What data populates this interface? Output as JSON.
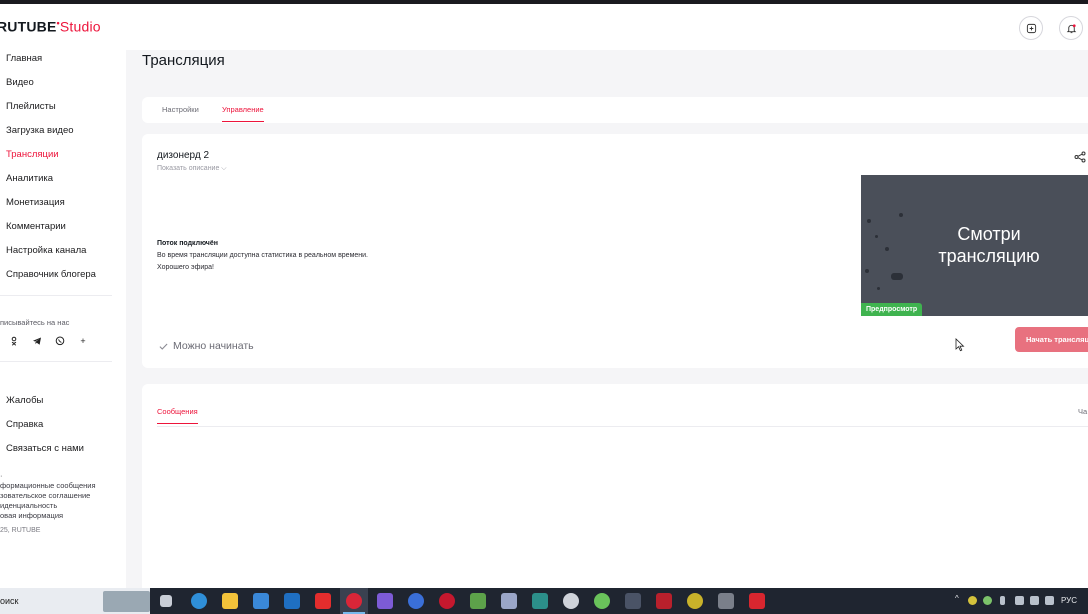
{
  "header": {
    "logo_main": "RUTUBE",
    "logo_studio": "Studio",
    "create_icon": "plus-square-icon",
    "notify_icon": "bell-icon"
  },
  "sidebar": {
    "items": [
      {
        "label": "Главная",
        "active": false
      },
      {
        "label": "Видео",
        "active": false
      },
      {
        "label": "Плейлисты",
        "active": false
      },
      {
        "label": "Загрузка видео",
        "active": false
      },
      {
        "label": "Трансляции",
        "active": true
      },
      {
        "label": "Аналитика",
        "active": false
      },
      {
        "label": "Монетизация",
        "active": false
      },
      {
        "label": "Комментарии",
        "active": false
      },
      {
        "label": "Настройка канала",
        "active": false
      },
      {
        "label": "Справочник блогера",
        "active": false
      }
    ],
    "subscribe_label": "писывайтесь на нас",
    "social_plus": "+",
    "support_items": [
      "Жалобы",
      "Справка",
      "Связаться с нами"
    ],
    "footer_links": [
      "формационные сообщения",
      "зовательское соглашение",
      "иденциальность",
      "овая информация"
    ],
    "footer_dot": "·",
    "copyright": "25, RUTUBE"
  },
  "main": {
    "page_title": "Трансляция",
    "tabs": [
      {
        "label": "Настройки",
        "active": false
      },
      {
        "label": "Управление",
        "active": true
      }
    ],
    "stream": {
      "title": "дизонерд 2",
      "show_description": "Показать описание ⌵",
      "status_title": "Поток подключён",
      "status_line1": "Во время трансляции доступна статистика в реальном времени.",
      "status_line2": "Хорошего эфира!",
      "ready_text": "Можно начинать",
      "preview_text": "Смотри трансляцию",
      "preview_badge": "Предпросмотр",
      "start_button": "Начать трансляцию"
    },
    "messages": {
      "tab_label": "Сообщения",
      "chat_label": "Ча"
    }
  },
  "taskbar": {
    "search_text": "оиск",
    "language": "РУС"
  },
  "colors": {
    "accent": "#ed143b",
    "success": "#3fb34f",
    "start_button": "#e8717f"
  }
}
